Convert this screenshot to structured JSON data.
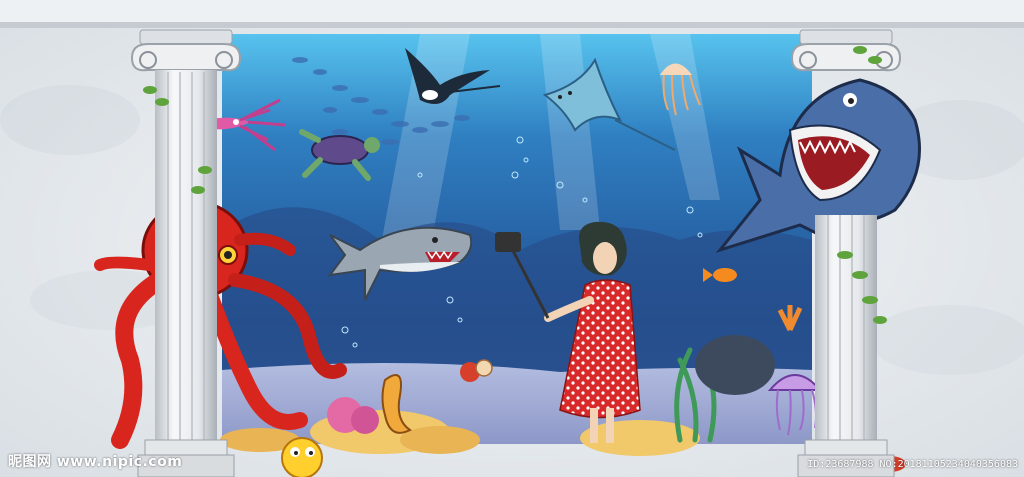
{
  "scene": {
    "description_colors": {
      "water_top": "#4fb7e6",
      "water_deep": "#1e4f8f",
      "sand": "#f1c86a",
      "wall": "#e8ecef",
      "octopus": "#d8261f",
      "dress": "#d82a2a"
    }
  },
  "watermark": {
    "left_text": "昵图网 www.nipic.com",
    "right_text": "ID:23687988 NO:20181105234040356083"
  }
}
